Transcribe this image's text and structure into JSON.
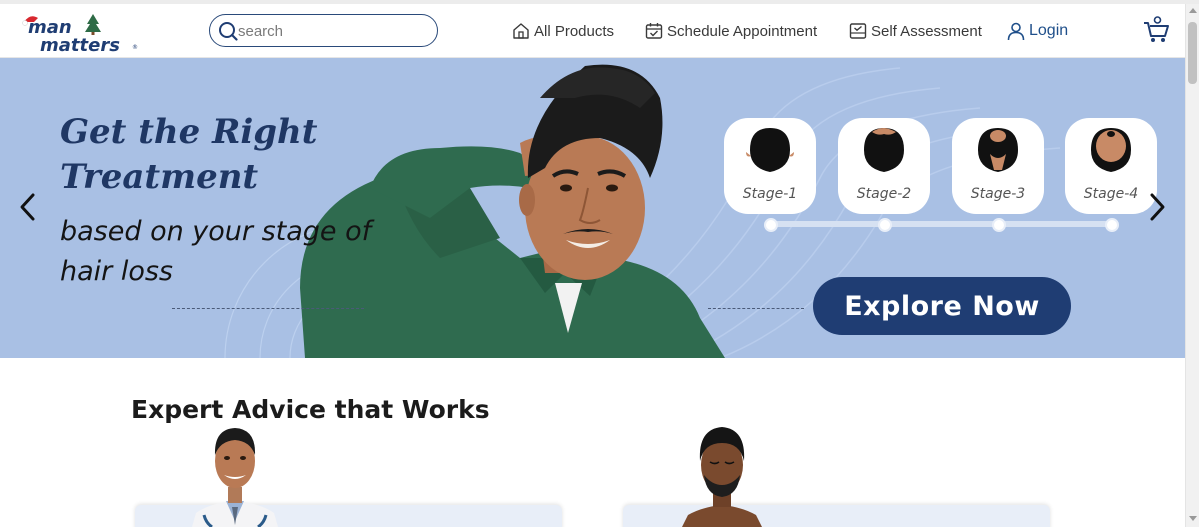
{
  "brand": {
    "line1": "man",
    "line2": "matters",
    "registered": "®"
  },
  "search": {
    "placeholder": "search"
  },
  "nav": {
    "all_products": "All Products",
    "schedule": "Schedule Appointment",
    "self_assessment": "Self Assessment",
    "login": "Login"
  },
  "hero": {
    "title": "Get the Right Treatment",
    "subtitle": "based on your stage of hair loss",
    "cta": "Explore Now",
    "stages": [
      {
        "label": "Stage-1"
      },
      {
        "label": "Stage-2"
      },
      {
        "label": "Stage-3"
      },
      {
        "label": "Stage-4"
      }
    ]
  },
  "section": {
    "title": "Expert Advice that Works"
  },
  "colors": {
    "banner_bg": "#a9c0e4",
    "navy": "#1f3d73",
    "title_blue": "#1f3764",
    "shirt_green": "#2f6b4f",
    "logo_red": "#d8282f"
  }
}
